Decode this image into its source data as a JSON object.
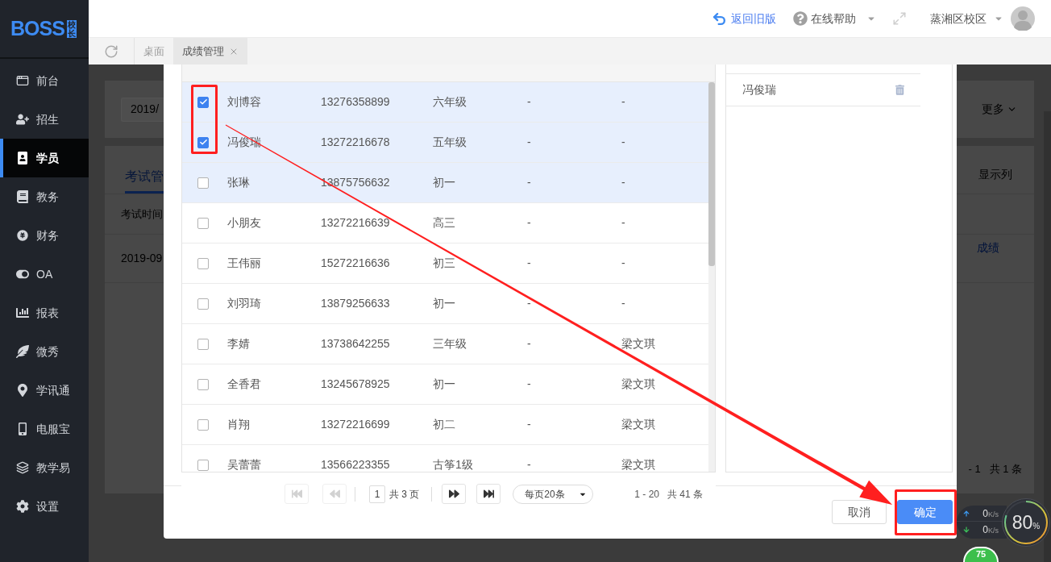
{
  "sidebar": {
    "logo": "BOSS",
    "logo_badge": "校长",
    "items": [
      {
        "label": "前台",
        "selected": false
      },
      {
        "label": "招生",
        "selected": false
      },
      {
        "label": "学员",
        "selected": true
      },
      {
        "label": "教务",
        "selected": false
      },
      {
        "label": "财务",
        "selected": false
      },
      {
        "label": "OA",
        "selected": false
      },
      {
        "label": "报表",
        "selected": false
      },
      {
        "label": "微秀",
        "selected": false
      },
      {
        "label": "学讯通",
        "selected": false
      },
      {
        "label": "电服宝",
        "selected": false
      },
      {
        "label": "教学易",
        "selected": false
      },
      {
        "label": "设置",
        "selected": false
      }
    ]
  },
  "header": {
    "back_link": "返回旧版",
    "help": "在线帮助",
    "campus": "蒸湘区校区"
  },
  "tabs": [
    {
      "label": "桌面",
      "selected": false,
      "closable": false
    },
    {
      "label": "成绩管理",
      "selected": true,
      "closable": true
    }
  ],
  "page": {
    "date_field": "2019/",
    "more_button": "更多",
    "tab": "考试管",
    "columns_button": "显示列",
    "column_1": "考试时间",
    "row_date": "2019-09",
    "row_link": "成绩",
    "pagination": "- 1   共 1 条"
  },
  "dialog": {
    "rows": [
      {
        "name": "刘博容",
        "phone": "13276358899",
        "grade": "六年级",
        "school": "-",
        "manager": "-",
        "selected": true,
        "highlighted": true
      },
      {
        "name": "冯俊瑞",
        "phone": "13272216678",
        "grade": "五年级",
        "school": "-",
        "manager": "-",
        "selected": true,
        "highlighted": true
      },
      {
        "name": "张琳",
        "phone": "13875756632",
        "grade": "初一",
        "school": "-",
        "manager": "-",
        "selected": false,
        "highlighted": true
      },
      {
        "name": "小朋友",
        "phone": "13272216639",
        "grade": "高三",
        "school": "-",
        "manager": "-",
        "selected": false,
        "highlighted": false
      },
      {
        "name": "王伟丽",
        "phone": "15272216636",
        "grade": "初三",
        "school": "-",
        "manager": "-",
        "selected": false,
        "highlighted": false
      },
      {
        "name": "刘羽琦",
        "phone": "13879256633",
        "grade": "初一",
        "school": "-",
        "manager": "-",
        "selected": false,
        "highlighted": false
      },
      {
        "name": "李婧",
        "phone": "13738642255",
        "grade": "三年级",
        "school": "-",
        "manager": "梁文琪",
        "selected": false,
        "highlighted": false
      },
      {
        "name": "全香君",
        "phone": "13245678925",
        "grade": "初一",
        "school": "-",
        "manager": "梁文琪",
        "selected": false,
        "highlighted": false
      },
      {
        "name": "肖翔",
        "phone": "13272216699",
        "grade": "初二",
        "school": "-",
        "manager": "梁文琪",
        "selected": false,
        "highlighted": false
      },
      {
        "name": "吴蕾蕾",
        "phone": "13566223355",
        "grade": "古筝1级",
        "school": "-",
        "manager": "梁文琪",
        "selected": false,
        "highlighted": false
      }
    ],
    "picked": [
      {
        "name": "冯俊瑞"
      }
    ],
    "pager": {
      "back": [
        {
          "kind": "first",
          "disabled": true
        },
        {
          "kind": "prev",
          "disabled": true
        }
      ],
      "page": "1",
      "pages": "共 3 页",
      "forward": [
        {
          "kind": "next",
          "disabled": false
        },
        {
          "kind": "last",
          "disabled": false
        }
      ],
      "page_size": "每页20条",
      "range": "1 - 20",
      "total": "共 41 条"
    },
    "buttons": [
      {
        "label": "取消",
        "kind": "secondary"
      },
      {
        "label": "确定",
        "kind": "primary"
      }
    ]
  },
  "monitor": {
    "upload": {
      "value": "0",
      "unit": "K/s"
    },
    "download": {
      "value": "0",
      "unit": "K/s"
    },
    "usage": {
      "value": "80",
      "unit": "%"
    },
    "badge": "75"
  }
}
